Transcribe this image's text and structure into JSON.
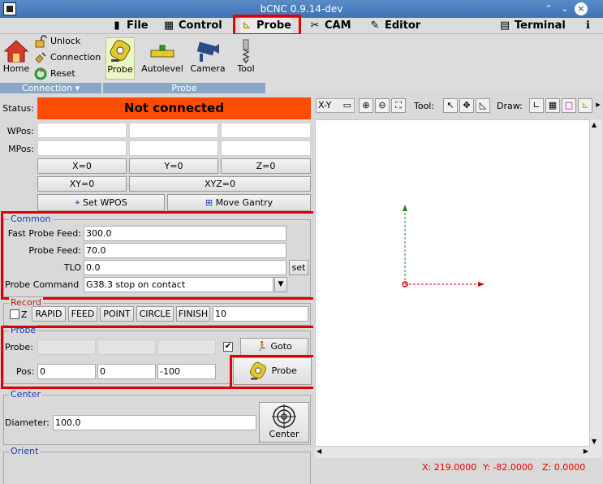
{
  "window": {
    "title": "bCNC 0.9.14-dev"
  },
  "menu": {
    "file": "File",
    "control": "Control",
    "probe": "Probe",
    "cam": "CAM",
    "editor": "Editor",
    "terminal": "Terminal"
  },
  "ribbon": {
    "home": "Home",
    "unlock": "Unlock",
    "connection": "Connection",
    "reset": "Reset",
    "connection_group": "Connection",
    "probe": "Probe",
    "autolevel": "Autolevel",
    "camera": "Camera",
    "tool": "Tool",
    "probe_group": "Probe"
  },
  "status": {
    "label": "Status:",
    "value": "Not connected",
    "wpos_label": "WPos:",
    "mpos_label": "MPos:"
  },
  "zero_buttons": {
    "x": "X=0",
    "y": "Y=0",
    "z": "Z=0",
    "xy": "XY=0",
    "xyz": "XYZ=0",
    "set_wpos": "Set WPOS",
    "move_gantry": "Move Gantry"
  },
  "common": {
    "title": "Common",
    "fast_feed_label": "Fast Probe Feed:",
    "fast_feed": "300.0",
    "probe_feed_label": "Probe Feed:",
    "probe_feed": "70.0",
    "tlo_label": "TLO",
    "tlo": "0.0",
    "set_button": "set",
    "command_label": "Probe Command",
    "command": "G38.3 stop on contact"
  },
  "record": {
    "title": "Record",
    "z": "Z",
    "rapid": "RAPID",
    "feed": "FEED",
    "point": "POINT",
    "circle": "CIRCLE",
    "finish": "FINISH",
    "value": "10"
  },
  "probe": {
    "title": "Probe",
    "probe_label": "Probe:",
    "pos_label": "Pos:",
    "pos_x": "0",
    "pos_y": "0",
    "pos_z": "-100",
    "goto_button": "Goto",
    "probe_button": "Probe",
    "checked": true
  },
  "center": {
    "title": "Center",
    "diameter_label": "Diameter:",
    "diameter": "100.0",
    "center_button": "Center"
  },
  "orient": {
    "title": "Orient"
  },
  "canvas_toolbar": {
    "view": "X-Y",
    "tool_label": "Tool:",
    "draw_label": "Draw:"
  },
  "coords": {
    "x": "X: 219.0000",
    "y": "Y: -82.0000",
    "z": "Z: 0.0000"
  },
  "colors": {
    "status_bg": "#ff4d00",
    "highlight_red": "#e00000",
    "axis_green": "#1a8a1a",
    "axis_red": "#e00000",
    "frame_title_blue": "#1b3ea8"
  }
}
